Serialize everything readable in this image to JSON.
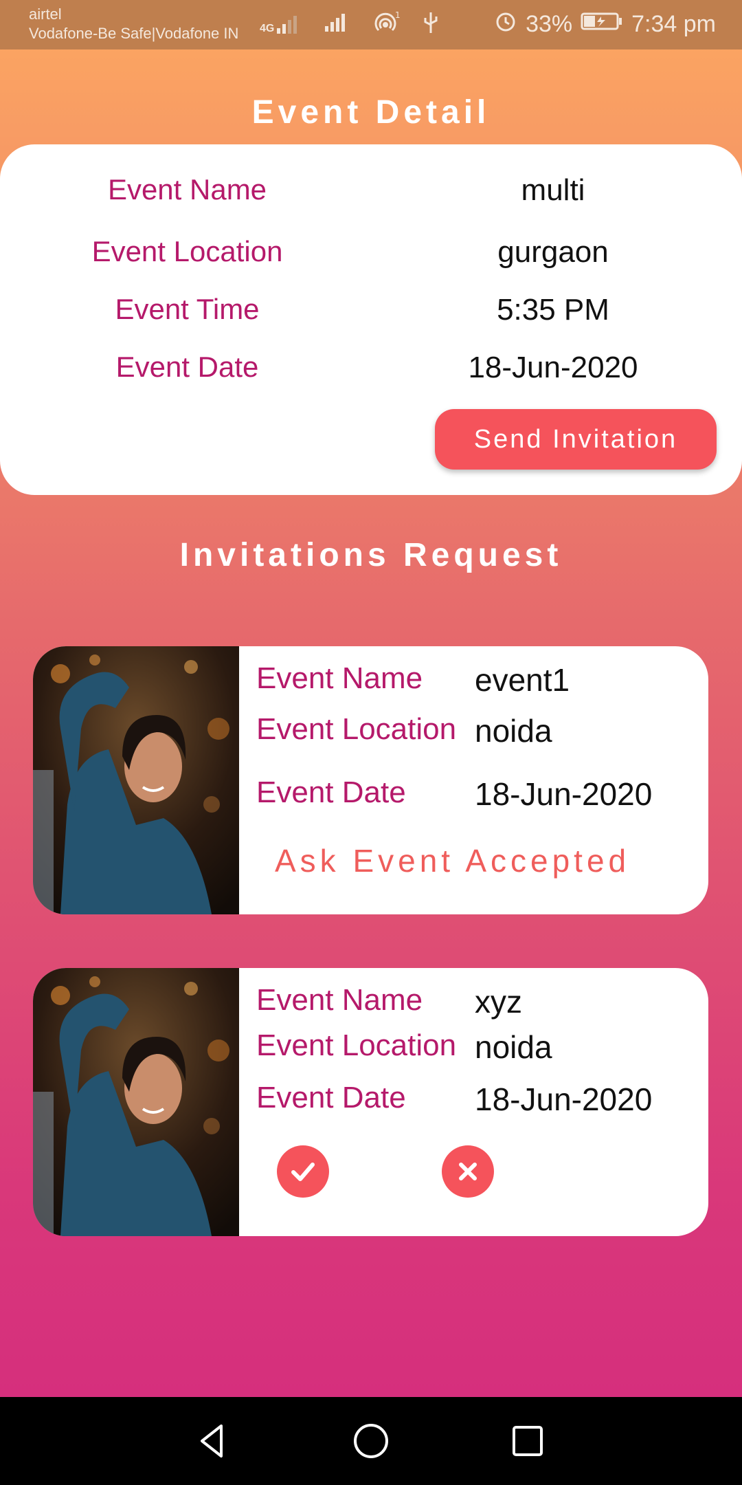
{
  "status_bar": {
    "carrier1": "airtel",
    "carrier2": "Vodafone-Be Safe|Vodafone IN",
    "network": "4G",
    "battery": "33%",
    "time": "7:34 pm"
  },
  "header": {
    "title": "Event Detail"
  },
  "event_detail": {
    "rows": [
      {
        "label": "Event Name",
        "value": "multi"
      },
      {
        "label": "Event Location",
        "value": "gurgaon"
      },
      {
        "label": "Event Time",
        "value": "5:35 PM"
      },
      {
        "label": "Event Date",
        "value": "18-Jun-2020"
      }
    ],
    "send_button": "Send Invitation"
  },
  "requests": {
    "title": "Invitations Request",
    "cards": [
      {
        "name_label": "Event Name",
        "name": "event1",
        "location_label": "Event Location",
        "location": "noida",
        "date_label": "Event Date",
        "date": "18-Jun-2020",
        "status": "Ask Event Accepted"
      },
      {
        "name_label": "Event Name",
        "name": "xyz",
        "location_label": "Event Location",
        "location": "noida",
        "date_label": "Event Date",
        "date": "18-Jun-2020",
        "accept_icon": "check-icon",
        "reject_icon": "close-icon"
      }
    ]
  },
  "nav": {
    "back_icon": "back-triangle-icon",
    "home_icon": "home-circle-icon",
    "recent_icon": "recents-square-icon"
  },
  "colors": {
    "accent": "#f5535b",
    "label": "#b5196a",
    "status_text": "#ef5d5b"
  }
}
